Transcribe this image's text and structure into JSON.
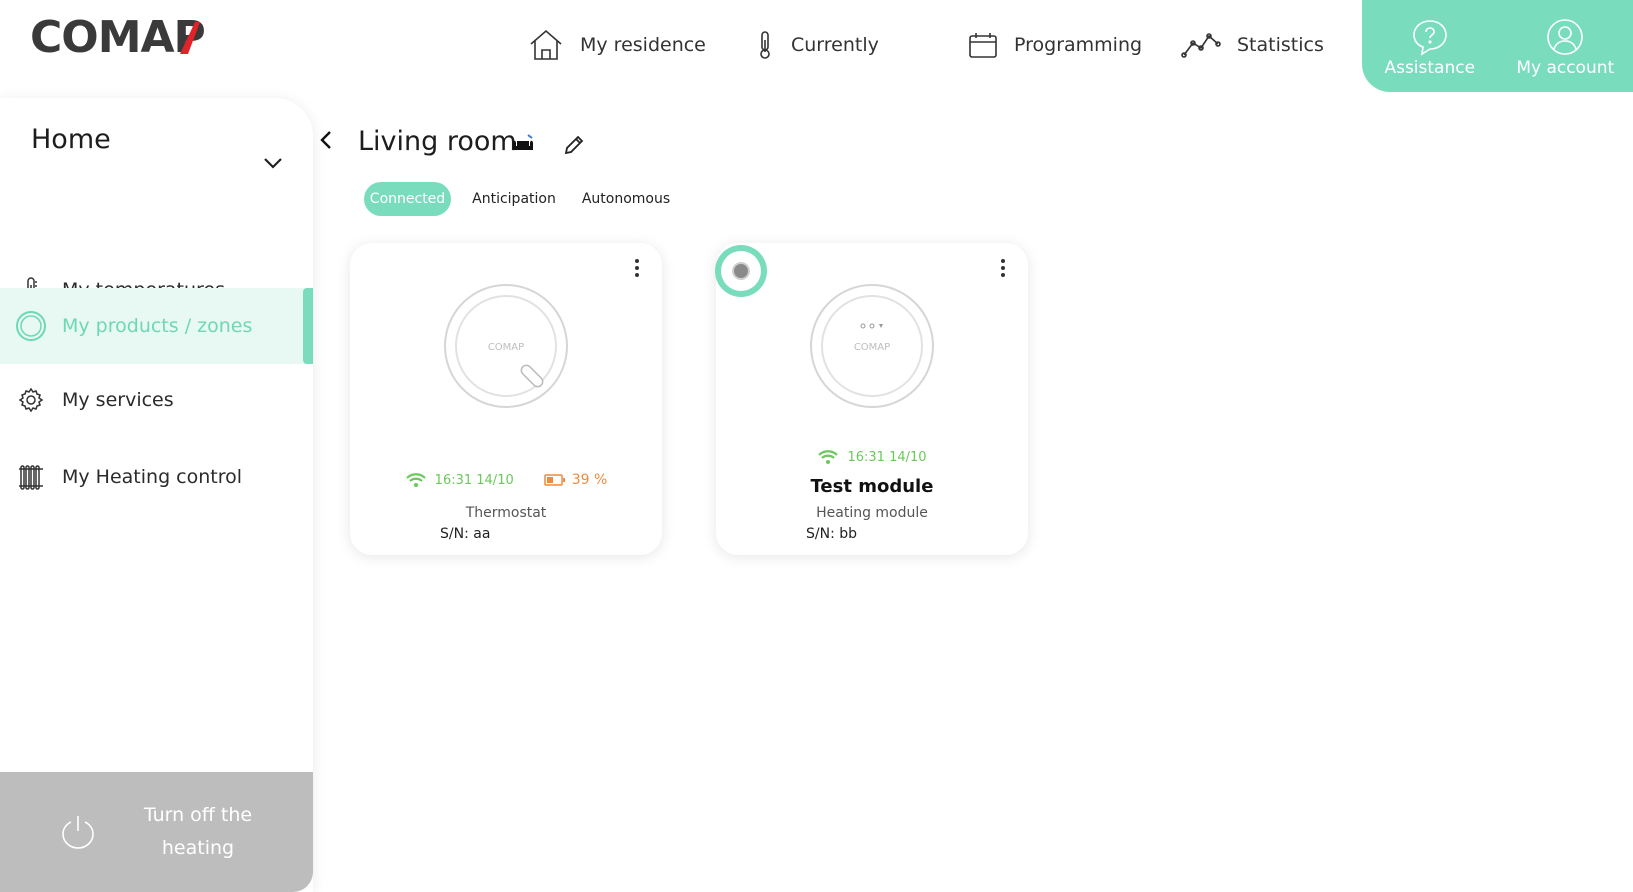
{
  "brand": {
    "logo_text": "COMAP",
    "accent": "#79dcbd",
    "logo_accent": "#e3222a"
  },
  "nav": {
    "residence": "My residence",
    "currently": "Currently",
    "programming": "Programming",
    "statistics": "Statistics"
  },
  "top_actions": {
    "assistance": "Assistance",
    "account": "My account"
  },
  "sidebar": {
    "home": "Home",
    "items": [
      {
        "label": "My temperatures",
        "icon": "thermometer-icon"
      },
      {
        "label": "My products / zones",
        "icon": "ring-icon",
        "active": true
      },
      {
        "label": "My services",
        "icon": "gear-icon"
      },
      {
        "label": "My Heating control",
        "icon": "radiator-icon"
      }
    ],
    "turnoff": "Turn off the heating"
  },
  "room": {
    "title": "Living room",
    "tabs": [
      "Connected",
      "Anticipation",
      "Autonomous"
    ],
    "active_tab": "Connected"
  },
  "devices": [
    {
      "time": "16:31 14/10",
      "battery": "39 %",
      "type": "Thermostat",
      "serial": "S/N: aa",
      "logo": "COMAP"
    },
    {
      "time": "16:31 14/10",
      "name": "Test module",
      "type": "Heating module",
      "serial": "S/N: bb",
      "logo": "COMAP"
    }
  ]
}
